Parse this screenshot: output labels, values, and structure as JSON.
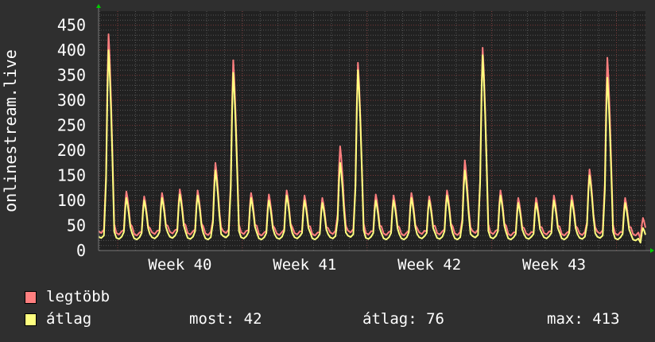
{
  "chart_data": {
    "type": "line",
    "ylabel": "onlinestream.live",
    "ylim": [
      0,
      478
    ],
    "yticks": [
      "0",
      "50",
      "100",
      "150",
      "200",
      "250",
      "300",
      "350",
      "400",
      "450"
    ],
    "ytick_values": [
      0,
      50,
      100,
      150,
      200,
      250,
      300,
      350,
      400,
      450
    ],
    "xticks": [
      "Week 40",
      "Week 41",
      "Week 42",
      "Week 43"
    ],
    "x_days": 30.7,
    "grid": true,
    "series": [
      {
        "name": "legtöbb",
        "color": "#ff7f7f",
        "daily_peak": [
          432,
          118,
          108,
          115,
          122,
          120,
          175,
          380,
          115,
          112,
          120,
          110,
          105,
          208,
          375,
          112,
          110,
          115,
          108,
          120,
          180,
          405,
          120,
          105,
          105,
          110,
          110,
          162,
          385,
          105,
          65
        ],
        "daily_low": [
          35,
          32,
          30,
          33,
          34,
          32,
          31,
          35,
          33,
          30,
          31,
          32,
          30,
          33,
          36,
          32,
          31,
          30,
          33,
          32,
          31,
          35,
          33,
          30,
          31,
          32,
          30,
          31,
          34,
          31,
          30
        ]
      },
      {
        "name": "átlag",
        "color": "#ffff7f",
        "daily_peak": [
          400,
          105,
          100,
          105,
          112,
          110,
          160,
          355,
          105,
          100,
          110,
          100,
          95,
          175,
          360,
          100,
          100,
          105,
          100,
          110,
          160,
          390,
          110,
          95,
          95,
          100,
          100,
          150,
          345,
          95,
          45
        ],
        "daily_low": [
          25,
          23,
          22,
          24,
          25,
          23,
          22,
          26,
          24,
          22,
          23,
          24,
          22,
          24,
          27,
          23,
          22,
          22,
          24,
          23,
          22,
          26,
          24,
          22,
          23,
          24,
          22,
          23,
          25,
          22,
          20
        ]
      }
    ],
    "legend": {
      "max_label": "legtöbb",
      "avg_label": "átlag",
      "stats": {
        "most": "most: 42",
        "atlag": "átlag: 76",
        "max": "max: 413"
      }
    }
  }
}
